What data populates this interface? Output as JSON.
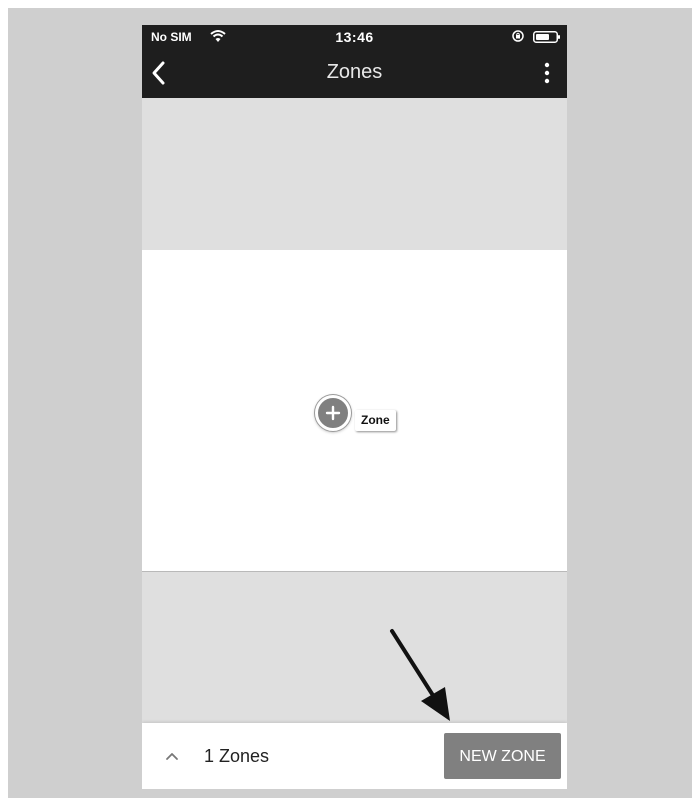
{
  "status_bar": {
    "carrier": "No SIM",
    "time": "13:46",
    "icons": [
      "wifi-icon",
      "orientation-lock-icon",
      "battery-icon"
    ]
  },
  "nav": {
    "title": "Zones",
    "back_icon": "chevron-left-icon",
    "menu_icon": "more-vertical-icon"
  },
  "map": {
    "marker": {
      "icon": "plus-icon",
      "label": "Zone"
    }
  },
  "bottom_bar": {
    "expand_icon": "chevron-up-icon",
    "zones_count": "1 Zones",
    "new_zone_label": "NEW ZONE"
  },
  "colors": {
    "header_bg": "#1e1e1e",
    "map_grey": "#dfdfdf",
    "button_grey": "#808080",
    "frame_grey": "#cfcfcf"
  }
}
